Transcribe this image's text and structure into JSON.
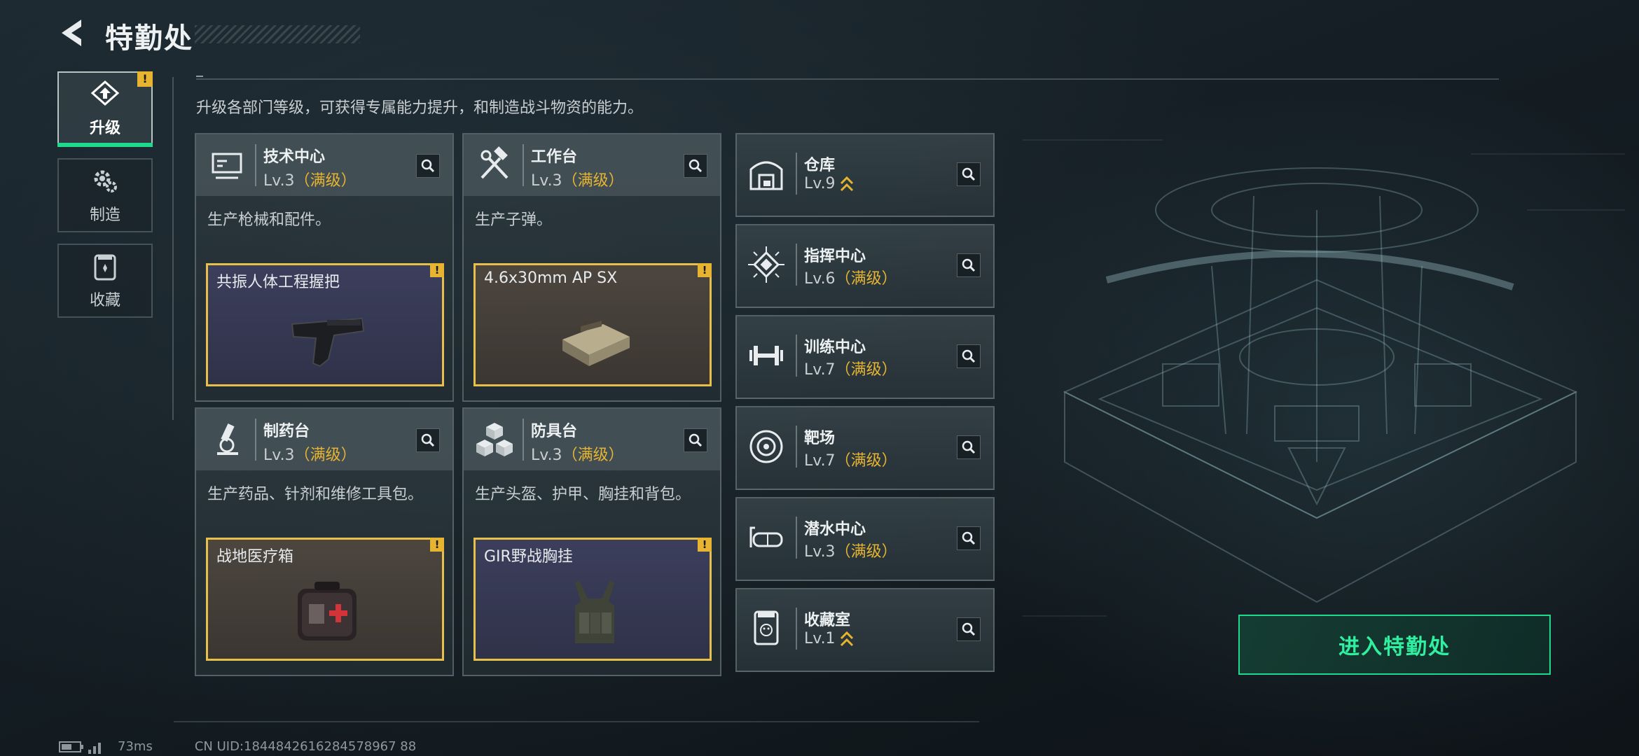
{
  "header": {
    "title": "特勤处"
  },
  "nav": {
    "items": [
      {
        "label": "升级",
        "icon": "upgrade-icon",
        "active": true,
        "alert": "!"
      },
      {
        "label": "制造",
        "icon": "gears-icon",
        "active": false
      },
      {
        "label": "收藏",
        "icon": "collection-icon",
        "active": false
      }
    ]
  },
  "description": "升级各部门等级，可获得专属能力提升，和制造战斗物资的能力。",
  "big_cards": [
    {
      "name": "技术中心",
      "level": "Lv.3",
      "max": "（满级）",
      "desc": "生产枪械和配件。",
      "craft": {
        "name": "共振人体工程握把",
        "alert": "!"
      }
    },
    {
      "name": "工作台",
      "level": "Lv.3",
      "max": "（满级）",
      "desc": "生产子弹。",
      "craft": {
        "name": "4.6x30mm AP SX",
        "alert": "!"
      }
    },
    {
      "name": "制药台",
      "level": "Lv.3",
      "max": "（满级）",
      "desc": "生产药品、针剂和维修工具包。",
      "craft": {
        "name": "战地医疗箱",
        "alert": "!"
      }
    },
    {
      "name": "防具台",
      "level": "Lv.3",
      "max": "（满级）",
      "desc": "生产头盔、护甲、胸挂和背包。",
      "craft": {
        "name": "GIR野战胸挂",
        "alert": "!"
      }
    }
  ],
  "small_cards": [
    {
      "name": "仓库",
      "level": "Lv.9",
      "max": ""
    },
    {
      "name": "指挥中心",
      "level": "Lv.6",
      "max": "（满级）"
    },
    {
      "name": "训练中心",
      "level": "Lv.7",
      "max": "（满级）"
    },
    {
      "name": "靶场",
      "level": "Lv.7",
      "max": "（满级）"
    },
    {
      "name": "潜水中心",
      "level": "Lv.3",
      "max": "（满级）"
    },
    {
      "name": "收藏室",
      "level": "Lv.1",
      "max": ""
    }
  ],
  "enter_button": "进入特勤处",
  "status": {
    "ping": "73ms",
    "uid": "CN UID:1844842616284578967 88"
  },
  "colors": {
    "accent": "#1fd98c",
    "max_level": "#e6b431",
    "slot_border": "#e6c04a"
  }
}
